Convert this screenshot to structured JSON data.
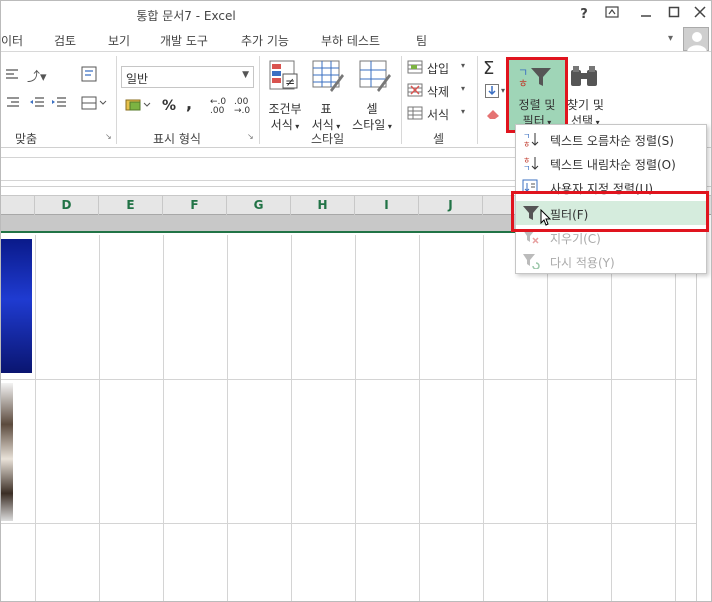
{
  "window": {
    "title": "통합 문서7 - Excel",
    "help_btn": "?"
  },
  "tabs": [
    "이터",
    "검토",
    "보기",
    "개발 도구",
    "추가 기능",
    "부하 테스트",
    "팀"
  ],
  "ribbon": {
    "align_group_label": "맞춤",
    "number_format_value": "일반",
    "number_group_label": "표시 형식",
    "percent_symbol": "%",
    "comma_symbol": ",",
    "dec_inc": "←.0 .00",
    "dec_dec": ".00 →.0",
    "conditional_format_label_1": "조건부",
    "conditional_format_label_2": "서식",
    "table_format_label_1": "표",
    "table_format_label_2": "서식",
    "cell_style_label_1": "셀",
    "cell_style_label_2": "스타일",
    "style_group_label": "스타일",
    "insert_label": "삽입",
    "delete_label": "삭제",
    "format_label": "서식",
    "cells_group_label": "셀",
    "sort_filter_label_1": "정렬 및",
    "sort_filter_label_2": "필터",
    "find_select_label_1": "찾기 및",
    "find_select_label_2": "선택"
  },
  "columns": [
    "D",
    "E",
    "F",
    "G",
    "H",
    "I",
    "J"
  ],
  "menu": {
    "items": [
      {
        "label": "텍스트 오름차순 정렬(S)",
        "icon": "sort-ascending-icon",
        "disabled": false
      },
      {
        "label": "텍스트 내림차순 정렬(O)",
        "icon": "sort-descending-icon",
        "disabled": false
      },
      {
        "label": "사용자 지정 정렬(U)...",
        "icon": "custom-sort-icon",
        "disabled": false
      },
      {
        "label": "필터(F)",
        "icon": "filter-icon",
        "disabled": false,
        "highlighted": true
      },
      {
        "label": "지우기(C)",
        "icon": "clear-filter-icon",
        "disabled": true
      },
      {
        "label": "다시 적용(Y)",
        "icon": "reapply-filter-icon",
        "disabled": true
      }
    ]
  },
  "colors": {
    "accent": "#217346",
    "highlight_box": "#e0141e",
    "menu_hover": "#d5ecdd",
    "ribbon_selected": "#9fd5b7"
  }
}
